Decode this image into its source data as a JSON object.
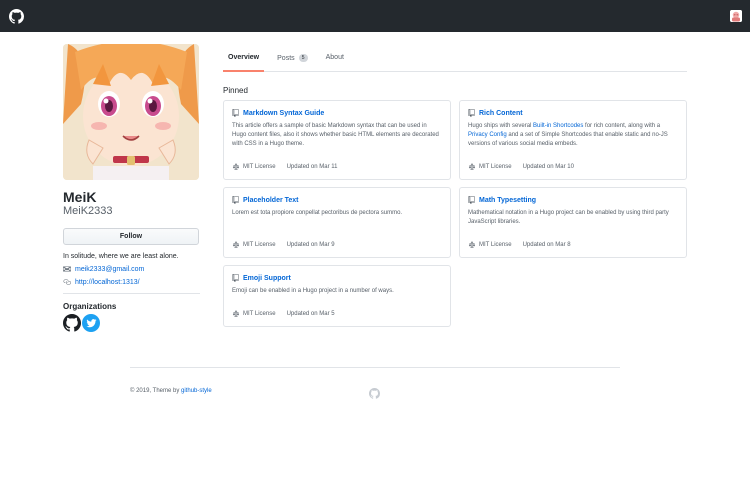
{
  "profile": {
    "name": "MeiK",
    "login": "MeiK2333",
    "follow_label": "Follow",
    "bio": "In solitude, where we are least alone.",
    "email": "meik2333@gmail.com",
    "website": "http://localhost:1313/",
    "organizations_title": "Organizations"
  },
  "tabs": [
    {
      "label": "Overview"
    },
    {
      "label": "Posts",
      "count": "5"
    },
    {
      "label": "About"
    }
  ],
  "pinned": {
    "title": "Pinned",
    "cards": [
      {
        "title": "Markdown Syntax Guide",
        "desc": "This article offers a sample of basic Markdown syntax that can be used in Hugo content files, also it shows whether basic HTML elements are decorated with CSS in a Hugo theme.",
        "license": "MIT License",
        "updated": "Updated on Mar 11"
      },
      {
        "title": "Rich Content",
        "desc_part1": "Hugo ships with several ",
        "desc_link1": "Built-in Shortcodes",
        "desc_part2": " for rich content, along with a ",
        "desc_link2": "Privacy Config",
        "desc_part3": " and a set of Simple Shortcodes that enable static and no-JS versions of various social media embeds.",
        "license": "MIT License",
        "updated": "Updated on Mar 10"
      },
      {
        "title": "Placeholder Text",
        "desc": "Lorem est tota propiore conpellat pectoribus de pectora summo.",
        "license": "MIT License",
        "updated": "Updated on Mar 9"
      },
      {
        "title": "Math Typesetting",
        "desc": "Mathematical notation in a Hugo project can be enabled by using third party JavaScript libraries.",
        "license": "MIT License",
        "updated": "Updated on Mar 8"
      },
      {
        "title": "Emoji Support",
        "desc": "Emoji can be enabled in a Hugo project in a number of ways.",
        "license": "MIT License",
        "updated": "Updated on Mar 5"
      }
    ]
  },
  "footer": {
    "text": "© 2019, Theme by ",
    "link": "github-style"
  },
  "colors": {
    "header_bg": "#24292e",
    "link": "#0366d6",
    "active_tab_underline": "#f9826c",
    "twitter": "#1da1f2"
  },
  "icons": [
    "github-logo-icon",
    "user-avatar-icon",
    "mail-icon",
    "link-icon",
    "repo-icon",
    "license-icon",
    "github-org-icon",
    "twitter-org-icon"
  ]
}
